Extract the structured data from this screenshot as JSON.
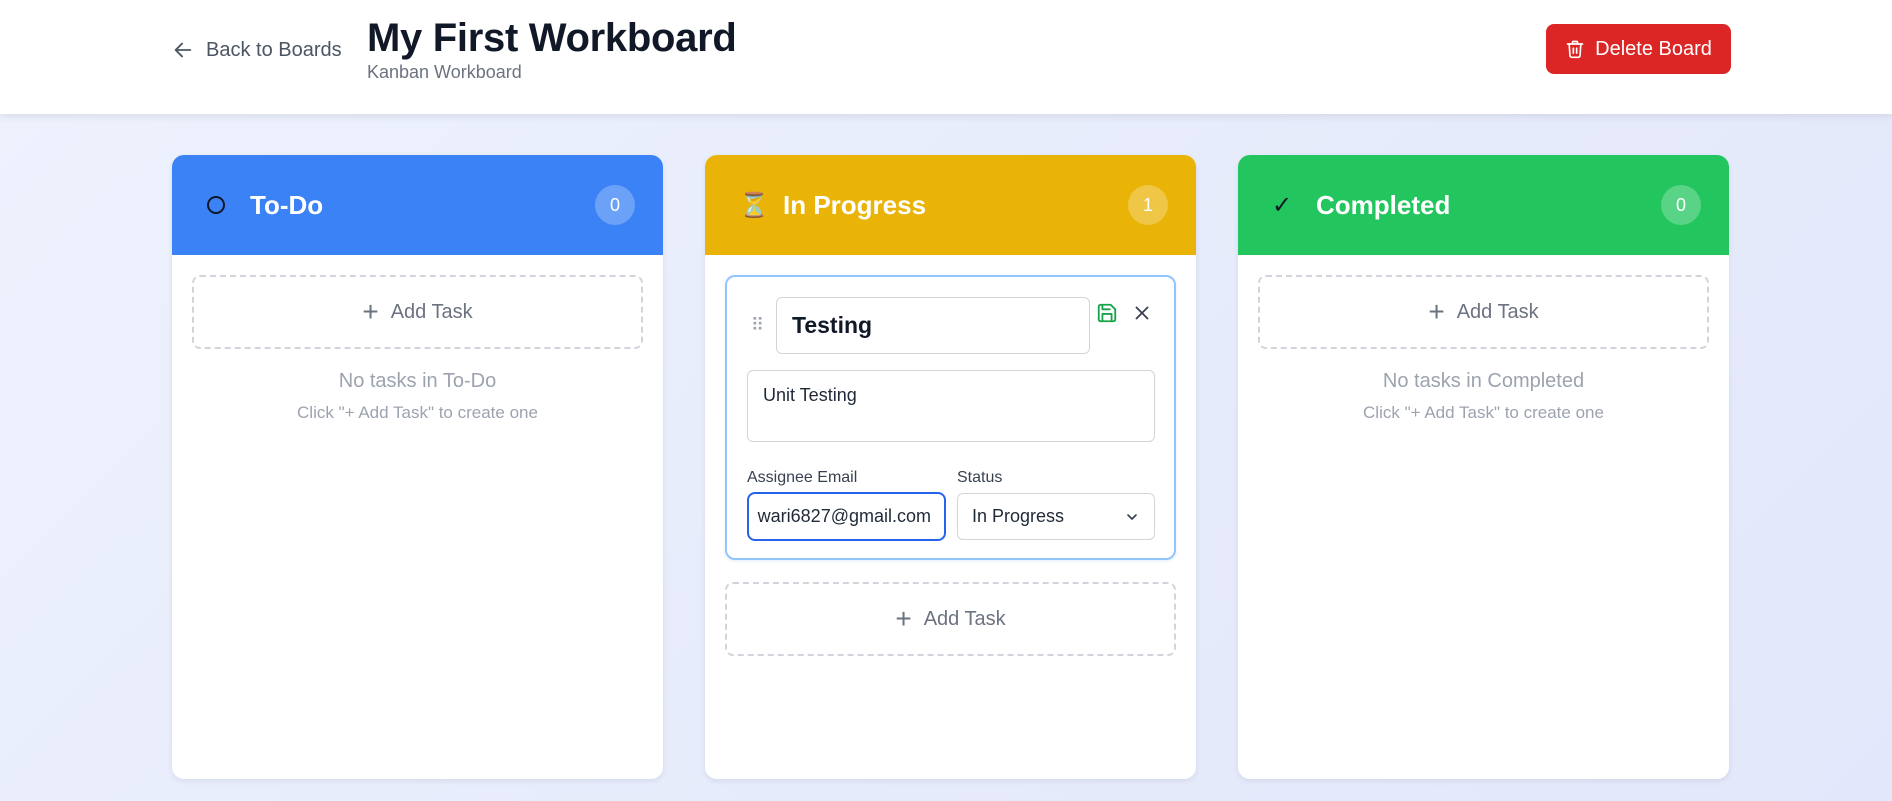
{
  "header": {
    "back_label": "Back to Boards",
    "title": "My First Workboard",
    "subtitle": "Kanban Workboard",
    "delete_label": "Delete Board"
  },
  "columns": [
    {
      "title": "To-Do",
      "icon": "circle-icon",
      "count": "0",
      "color": "#3b82f6",
      "add_label": "Add Task",
      "empty_main": "No tasks in To-Do",
      "empty_hint": "Click \"+ Add Task\" to create one"
    },
    {
      "title": "In Progress",
      "icon": "hourglass-icon",
      "icon_glyph": "⏳",
      "count": "1",
      "color": "#eab308",
      "add_label": "Add Task"
    },
    {
      "title": "Completed",
      "icon": "check-icon",
      "icon_glyph": "✓",
      "count": "0",
      "color": "#22c55e",
      "add_label": "Add Task",
      "empty_main": "No tasks in Completed",
      "empty_hint": "Click \"+ Add Task\" to create one"
    }
  ],
  "task_edit": {
    "title_value": "Testing",
    "description_value": "Unit Testing",
    "assignee_label": "Assignee Email",
    "assignee_value": "wari6827@gmail.com",
    "status_label": "Status",
    "status_value": "In Progress"
  },
  "colors": {
    "delete": "#dc2626",
    "focus": "#2563eb",
    "save": "#16a34a"
  }
}
